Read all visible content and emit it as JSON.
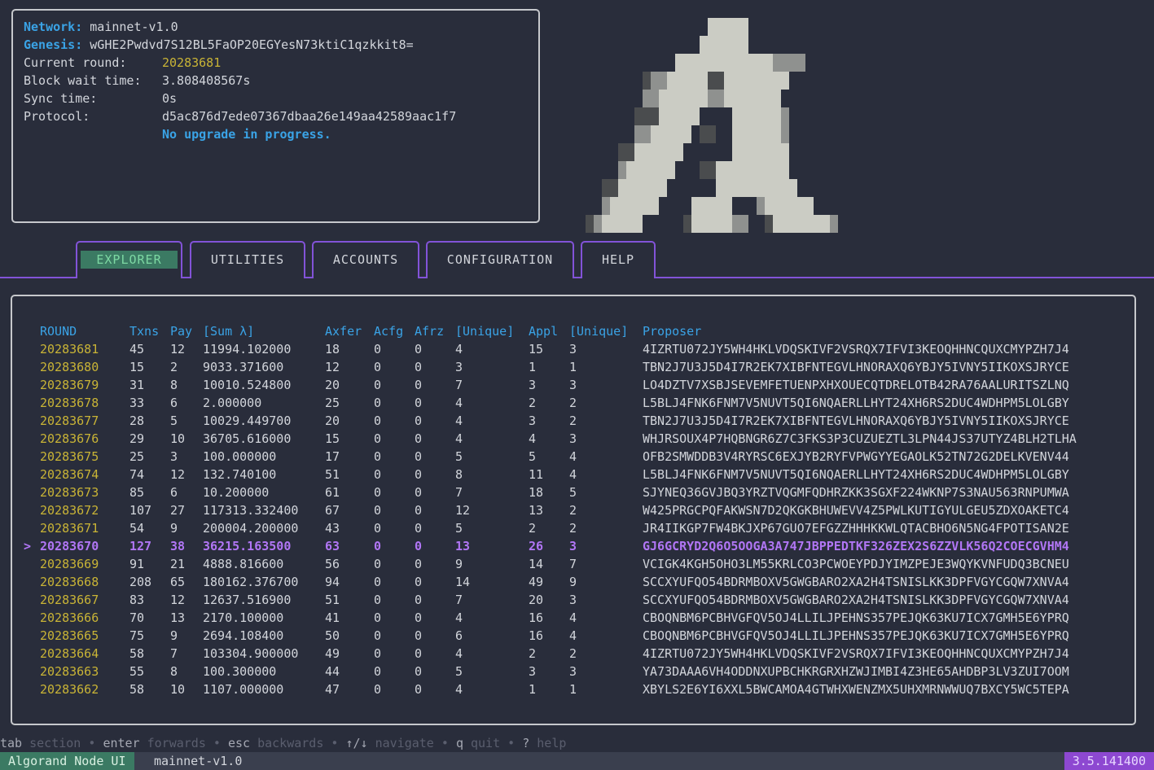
{
  "status": {
    "network_label": "Network:",
    "network": "mainnet-v1.0",
    "genesis_label": "Genesis:",
    "genesis": "wGHE2Pwdvd7S12BL5FaOP20EGYesN73ktiC1qzkkit8=",
    "round_label": "Current round:",
    "round": "20283681",
    "wait_label": "Block wait time:",
    "wait": "3.808408567s",
    "sync_label": "Sync time:",
    "sync": "0s",
    "protocol_label": "Protocol:",
    "protocol": "d5ac876d7ede07367dbaa26e149aa42589aac1f7",
    "upgrade": "No upgrade in progress."
  },
  "logo": "algorand-logo-icon",
  "tabs": [
    {
      "label": "EXPLORER",
      "active": true
    },
    {
      "label": "UTILITIES"
    },
    {
      "label": "ACCOUNTS"
    },
    {
      "label": "CONFIGURATION"
    },
    {
      "label": "HELP"
    }
  ],
  "table": {
    "columns": [
      "ROUND",
      "Txns",
      "Pay",
      "[Sum λ]",
      "Axfer",
      "Acfg",
      "Afrz",
      "[Unique]",
      "Appl",
      "[Unique]",
      "Proposer"
    ],
    "selected_marker": ">",
    "selected_round": "20283670",
    "rows": [
      [
        "20283681",
        "45",
        "12",
        "11994.102000",
        "18",
        "0",
        "0",
        "4",
        "15",
        "3",
        "4IZRTU072JY5WH4HKLVDQSKIVF2VSRQX7IFVI3KEOQHHNCQUXCMYPZH7J4"
      ],
      [
        "20283680",
        "15",
        "2",
        "9033.371600",
        "12",
        "0",
        "0",
        "3",
        "1",
        "1",
        "TBN2J7U3J5D4I7R2EK7XIBFNTEGVLHNORAXQ6YBJY5IVNY5IIKOXSJRYCE"
      ],
      [
        "20283679",
        "31",
        "8",
        "10010.524800",
        "20",
        "0",
        "0",
        "7",
        "3",
        "3",
        "LO4DZTV7XSBJSEVEMFETUENPXHXOUECQTDRELOTB42RA76AALURITSZLNQ"
      ],
      [
        "20283678",
        "33",
        "6",
        "2.000000",
        "25",
        "0",
        "0",
        "4",
        "2",
        "2",
        "L5BLJ4FNK6FNM7V5NUVT5QI6NQAERLLHYT24XH6RS2DUC4WDHPM5LOLGBY"
      ],
      [
        "20283677",
        "28",
        "5",
        "10029.449700",
        "20",
        "0",
        "0",
        "4",
        "3",
        "2",
        "TBN2J7U3J5D4I7R2EK7XIBFNTEGVLHNORAXQ6YBJY5IVNY5IIKOXSJRYCE"
      ],
      [
        "20283676",
        "29",
        "10",
        "36705.616000",
        "15",
        "0",
        "0",
        "4",
        "4",
        "3",
        "WHJRSOUX4P7HQBNGR6Z7C3FKS3P3CUZUEZTL3LPN44JS37UTYZ4BLH2TLHA"
      ],
      [
        "20283675",
        "25",
        "3",
        "100.000000",
        "17",
        "0",
        "0",
        "5",
        "5",
        "4",
        "OFB2SMWDDB3V4RYRSC6EXJYB2RYFVPWGYYEGAOLK52TN72G2DELKVENV44"
      ],
      [
        "20283674",
        "74",
        "12",
        "132.740100",
        "51",
        "0",
        "0",
        "8",
        "11",
        "4",
        "L5BLJ4FNK6FNM7V5NUVT5QI6NQAERLLHYT24XH6RS2DUC4WDHPM5LOLGBY"
      ],
      [
        "20283673",
        "85",
        "6",
        "10.200000",
        "61",
        "0",
        "0",
        "7",
        "18",
        "5",
        "SJYNEQ36GVJBQ3YRZTVQGMFQDHRZKK3SGXF224WKNP7S3NAU563RNPUMWA"
      ],
      [
        "20283672",
        "107",
        "27",
        "117313.332400",
        "67",
        "0",
        "0",
        "12",
        "13",
        "2",
        "W425PRGCPQFAKWSN7D2QKGKBHUWEVV4Z5PWLKUTIGYULGEU5ZDXOAKETC4"
      ],
      [
        "20283671",
        "54",
        "9",
        "200004.200000",
        "43",
        "0",
        "0",
        "5",
        "2",
        "2",
        "JR4IIKGP7FW4BKJXP67GUO7EFGZZHHHKKWLQTACBHO6N5NG4FPOTISAN2E"
      ],
      [
        "20283670",
        "127",
        "38",
        "36215.163500",
        "63",
        "0",
        "0",
        "13",
        "26",
        "3",
        "GJ6GCRYD2Q6O5OOGA3A747JBPPEDTKF326ZEX2S6ZZVLK56Q2COECGVHM4"
      ],
      [
        "20283669",
        "91",
        "21",
        "4888.816600",
        "56",
        "0",
        "0",
        "9",
        "14",
        "7",
        "VCIGK4KGH5OHO3LM55KRLCO3PCWOEYPDJYIMZPEJE3WQYKVNFUDQ3BCNEU"
      ],
      [
        "20283668",
        "208",
        "65",
        "180162.376700",
        "94",
        "0",
        "0",
        "14",
        "49",
        "9",
        "SCCXYUFQO54BDRMBOXV5GWGBARO2XA2H4TSNISLKK3DPFVGYCGQW7XNVA4"
      ],
      [
        "20283667",
        "83",
        "12",
        "12637.516900",
        "51",
        "0",
        "0",
        "7",
        "20",
        "3",
        "SCCXYUFQO54BDRMBOXV5GWGBARO2XA2H4TSNISLKK3DPFVGYCGQW7XNVA4"
      ],
      [
        "20283666",
        "70",
        "13",
        "2170.100000",
        "41",
        "0",
        "0",
        "4",
        "16",
        "4",
        "CBOQNBM6PCBHVGFQV5OJ4LLILJPEHNS357PEJQK63KU7ICX7GMH5E6YPRQ"
      ],
      [
        "20283665",
        "75",
        "9",
        "2694.108400",
        "50",
        "0",
        "0",
        "6",
        "16",
        "4",
        "CBOQNBM6PCBHVGFQV5OJ4LLILJPEHNS357PEJQK63KU7ICX7GMH5E6YPRQ"
      ],
      [
        "20283664",
        "58",
        "7",
        "103304.900000",
        "49",
        "0",
        "0",
        "4",
        "2",
        "2",
        "4IZRTU072JY5WH4HKLVDQSKIVF2VSRQX7IFVI3KEOQHHNCQUXCMYPZH7J4"
      ],
      [
        "20283663",
        "55",
        "8",
        "100.300000",
        "44",
        "0",
        "0",
        "5",
        "3",
        "3",
        "YA73DAAA6VH4ODDNXUPBCHKRGRXHZWJIMBI4Z3HE65AHDBP3LV3ZUI7OOM"
      ],
      [
        "20283662",
        "58",
        "10",
        "1107.000000",
        "47",
        "0",
        "0",
        "4",
        "1",
        "1",
        "XBYLS2E6YI6XXL5BWCAMOA4GTWHXWENZMX5UHXMRNWWUQ7BXCY5WC5TEPA"
      ]
    ]
  },
  "hints": [
    {
      "key": "tab",
      "desc": "section"
    },
    {
      "key": "enter",
      "desc": "forwards"
    },
    {
      "key": "esc",
      "desc": "backwards"
    },
    {
      "key": "↑/↓",
      "desc": "navigate"
    },
    {
      "key": "q",
      "desc": "quit"
    },
    {
      "key": "?",
      "desc": "help"
    }
  ],
  "hint_separator": "•",
  "statusbar": {
    "app": "Algorand Node UI",
    "network": "mainnet-v1.0",
    "version": "3.5.141400"
  },
  "colors": {
    "background": "#292d3b",
    "accent": "#8253d8",
    "round": "#c9b436",
    "header": "#3aa3e6",
    "selected": "#b176f5",
    "active_tab": "#3b7a63"
  }
}
